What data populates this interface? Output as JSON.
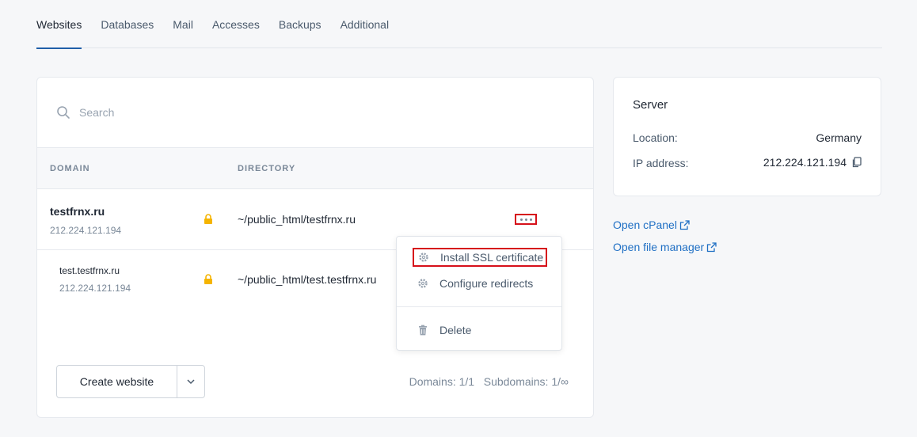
{
  "tabs": [
    {
      "label": "Websites",
      "active": true
    },
    {
      "label": "Databases"
    },
    {
      "label": "Mail"
    },
    {
      "label": "Accesses"
    },
    {
      "label": "Backups"
    },
    {
      "label": "Additional"
    }
  ],
  "search": {
    "placeholder": "Search"
  },
  "table": {
    "headers": {
      "domain": "DOMAIN",
      "directory": "DIRECTORY"
    },
    "rows": [
      {
        "domain": "testfrnx.ru",
        "ip": "212.224.121.194",
        "directory": "~/public_html/testfrnx.ru"
      },
      {
        "domain": "test.testfrnx.ru",
        "ip": "212.224.121.194",
        "directory": "~/public_html/test.testfrnx.ru"
      }
    ]
  },
  "menu": {
    "install_ssl": "Install SSL certificate",
    "configure_redirects": "Configure redirects",
    "delete": "Delete"
  },
  "footer": {
    "create_label": "Create website",
    "domains_count": "Domains: 1/1",
    "subdomains_count": "Subdomains: 1/∞"
  },
  "server": {
    "title": "Server",
    "location_label": "Location:",
    "location_value": "Germany",
    "ip_label": "IP address:",
    "ip_value": "212.224.121.194"
  },
  "links": {
    "cpanel": "Open cPanel",
    "file_manager": "Open file manager"
  },
  "colors": {
    "accent": "#1f5fa8",
    "link": "#1f6fc4",
    "highlight": "#d6101a",
    "lock": "#f5b400"
  }
}
